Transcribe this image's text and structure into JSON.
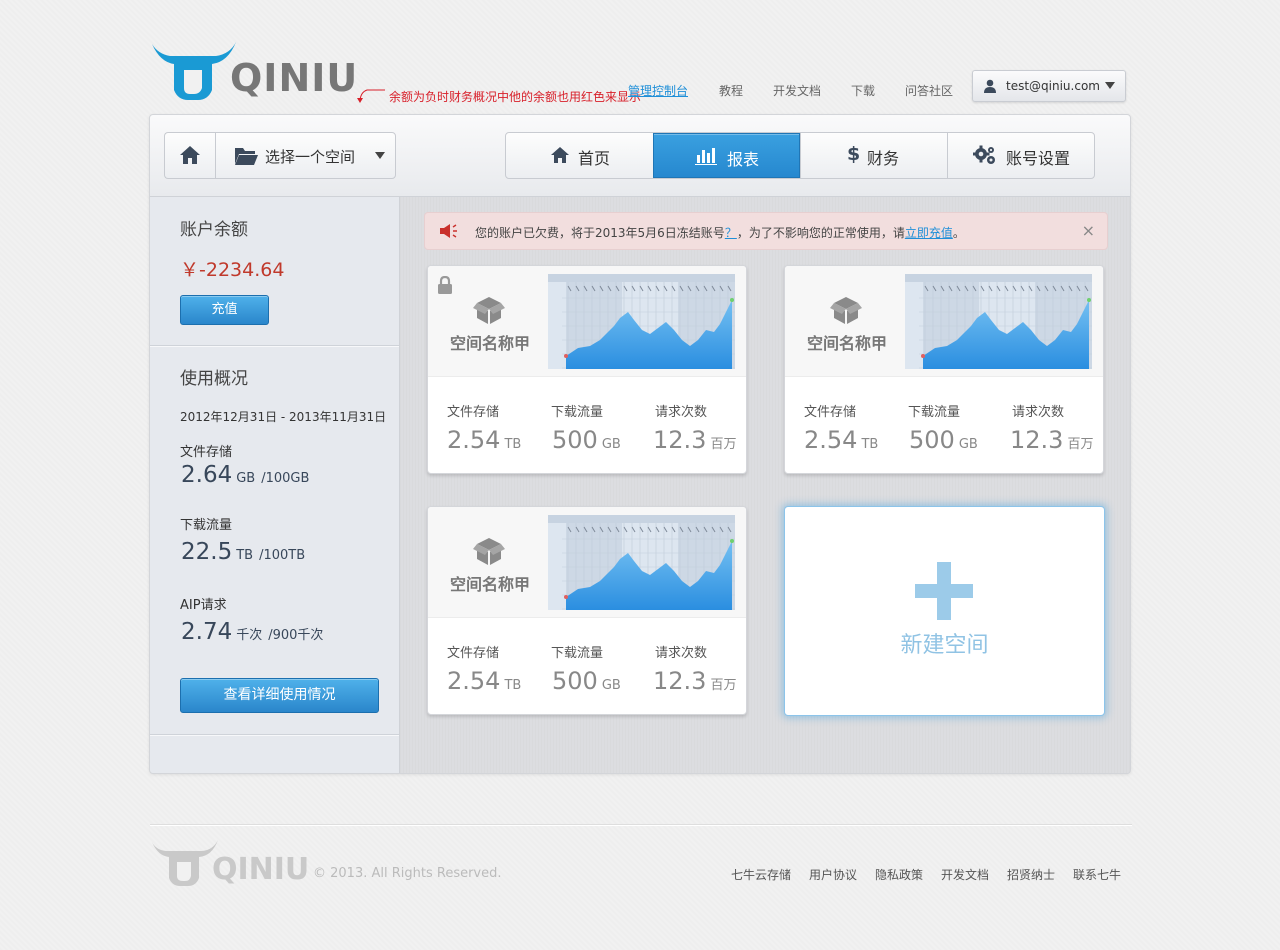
{
  "header": {
    "logo_text": "QINIU",
    "annotation": "余额为负时财务概况中他的余额也用红色来显示",
    "nav": [
      "管理控制台",
      "教程",
      "开发文档",
      "下载",
      "问答社区"
    ],
    "user_email": "test@qiniu.com"
  },
  "toolbar": {
    "space_select": "选择一个空间",
    "tabs": [
      "首页",
      "报表",
      "财务",
      "账号设置"
    ],
    "active_tab": "报表"
  },
  "sidebar": {
    "balance_title": "账户余额",
    "balance": "￥-2234.64",
    "recharge_button": "充值",
    "usage_title": "使用概况",
    "date_range": "2012年12月31日 - 2013年11月31日",
    "stats": [
      {
        "label": "文件存储",
        "value": "2.64",
        "unit": "GB",
        "quota": "/100GB"
      },
      {
        "label": "下载流量",
        "value": "22.5",
        "unit": "TB",
        "quota": "/100TB"
      },
      {
        "label": "AIP请求",
        "value": "2.74",
        "unit": "千次",
        "quota": "/900千次"
      }
    ],
    "detail_button": "查看详细使用情况"
  },
  "alert": {
    "pre": "您的账户已欠费，将于2013年5月6日冻结账号",
    "q": "？",
    "mid": "，为了不影响您的正常使用，请",
    "link": "立即充值",
    "end": "。",
    "close": "×"
  },
  "cards": [
    {
      "name": "空间名称甲",
      "locked": true,
      "metrics": [
        {
          "label": "文件存储",
          "value": "2.54",
          "unit": "TB"
        },
        {
          "label": "下载流量",
          "value": "500",
          "unit": "GB"
        },
        {
          "label": "请求次数",
          "value": "12.3",
          "unit": "百万"
        }
      ]
    },
    {
      "name": "空间名称甲",
      "locked": false,
      "metrics": [
        {
          "label": "文件存储",
          "value": "2.54",
          "unit": "TB"
        },
        {
          "label": "下载流量",
          "value": "500",
          "unit": "GB"
        },
        {
          "label": "请求次数",
          "value": "12.3",
          "unit": "百万"
        }
      ]
    },
    {
      "name": "空间名称甲",
      "locked": false,
      "metrics": [
        {
          "label": "文件存储",
          "value": "2.54",
          "unit": "TB"
        },
        {
          "label": "下载流量",
          "value": "500",
          "unit": "GB"
        },
        {
          "label": "请求次数",
          "value": "12.3",
          "unit": "百万"
        }
      ]
    }
  ],
  "new_space_label": "新建空间",
  "footer": {
    "copyright": "© 2013. All Rights Reserved.",
    "links": [
      "七牛云存储",
      "用户协议",
      "隐私政策",
      "开发文档",
      "招贤纳士",
      "联系七牛"
    ]
  },
  "colors": {
    "accent": "#2a8fd6",
    "negative": "#c0392b",
    "alert_bg": "#f2dede"
  },
  "icons": [
    "logo-bull-icon",
    "user-icon",
    "home-icon",
    "folder-icon",
    "bar-chart-icon",
    "dollar-icon",
    "gears-icon",
    "speaker-icon",
    "lock-icon",
    "box-icon",
    "plus-icon"
  ]
}
